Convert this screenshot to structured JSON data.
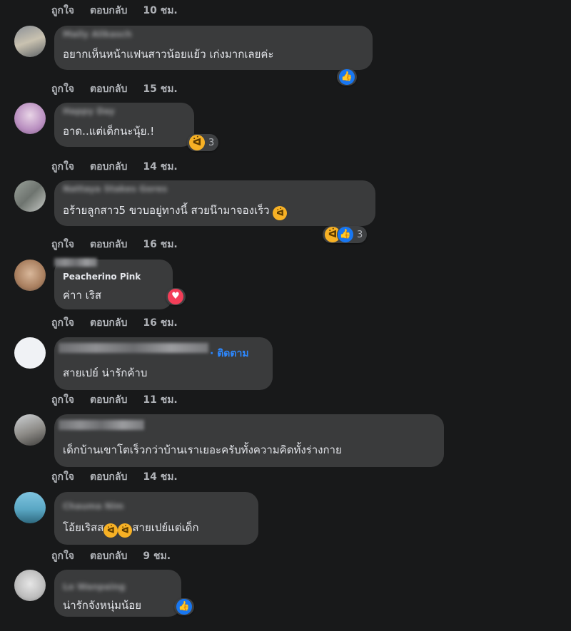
{
  "labels": {
    "like": "ถูกใจ",
    "reply": "ตอบกลับ",
    "follow": "· ติดตาม"
  },
  "top_time": "10 ชม.",
  "comments": [
    {
      "author": "Maily Alikasch",
      "text": "อยากเห็นหน้าแฟนสาวน้อยแย้ว เก่งมากเลยค่ะ",
      "time": "15 ชม.",
      "reaction_count": ""
    },
    {
      "author": "Happy Day",
      "text": "อาด..แต่เด็กนะนุ้ย.!",
      "time": "14 ชม.",
      "reaction_count": "3"
    },
    {
      "author": "Nattaya Stakes Gores",
      "text": "อร้ายลูกสาว5 ขวบอยู่ทางนี้ สวยน๊ามาจองเร็ว",
      "time": "16 ชม.",
      "reaction_count": "3"
    },
    {
      "author": "Peacherino Pink",
      "text": "ค่าา เริส",
      "time": "16 ชม.",
      "reaction_count": ""
    },
    {
      "author": "",
      "text": "สายเปย์ น่ารักค้าบ",
      "time": "11 ชม.",
      "reaction_count": ""
    },
    {
      "author": "",
      "text": "เด็กบ้านเขาโตเร็วกว่าบ้านเราเยอะครับทั้งความคิดทั้งร่างกาย",
      "time": "14 ชม.",
      "reaction_count": ""
    },
    {
      "author": "Chauma Nim",
      "text": "โอ้ยเริสส",
      "text2": "สายเปย์แต่เด็ก",
      "time": "9 ชม.",
      "reaction_count": ""
    },
    {
      "author": "Lo Wanpaing",
      "text": "น่ารักจังหนุ่มน้อย",
      "time": "",
      "reaction_count": ""
    }
  ],
  "colors": {
    "background": "#18191a",
    "bubble": "#3a3b3c",
    "link": "#2d88ff",
    "like": "#1877f2",
    "love": "#f33e58",
    "haha": "#f7b125"
  },
  "icons": [
    "like-icon",
    "haha-icon",
    "love-icon",
    "avatar"
  ]
}
